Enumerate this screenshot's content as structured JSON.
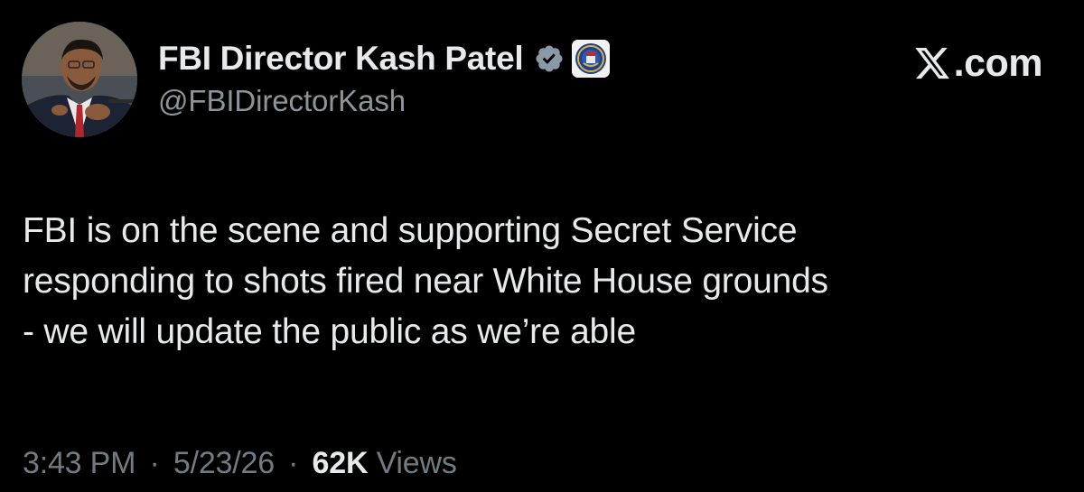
{
  "author": {
    "display_name": "FBI Director Kash Patel",
    "handle": "@FBIDirectorKash",
    "verified_icon": "verified-badge-icon",
    "org_badge_icon": "fbi-seal-icon"
  },
  "brand": {
    "icon": "x-logo-icon",
    "label": ".com"
  },
  "tweet": {
    "text": "FBI is on the scene and supporting Secret Service\nresponding to shots fired near White House grounds\n- we will update the public as we’re able"
  },
  "meta": {
    "time": "3:43 PM",
    "separator": "·",
    "date": "5/23/26",
    "views_count": "62K",
    "views_label": "Views"
  },
  "colors": {
    "background": "#000000",
    "primary_text": "#e7e9ea",
    "secondary_text": "#8d949a",
    "verified": "#8b98a5"
  }
}
